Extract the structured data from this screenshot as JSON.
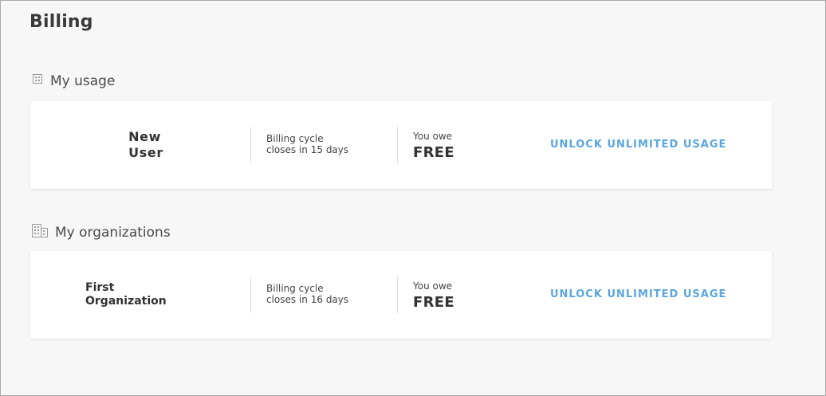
{
  "page": {
    "title": "Billing"
  },
  "usage_section": {
    "header": "My usage",
    "icon": "building-small-icon",
    "card": {
      "name_line1": "New",
      "name_line2": "User",
      "cycle_line1": "Billing cycle",
      "cycle_line2": "closes in 15 days",
      "owe_label": "You owe",
      "owe_value": "FREE",
      "action": "UNLOCK UNLIMITED USAGE"
    }
  },
  "orgs_section": {
    "header": "My organizations",
    "icon": "buildings-icon",
    "card": {
      "name_line1": "First",
      "name_line2": "Organization",
      "cycle_line1": "Billing cycle",
      "cycle_line2": "closes in 16 days",
      "owe_label": "You owe",
      "owe_value": "FREE",
      "action": "UNLOCK UNLIMITED USAGE"
    }
  },
  "colors": {
    "accent": "#5aa6de",
    "background": "#f7f7f7",
    "card": "#ffffff"
  }
}
